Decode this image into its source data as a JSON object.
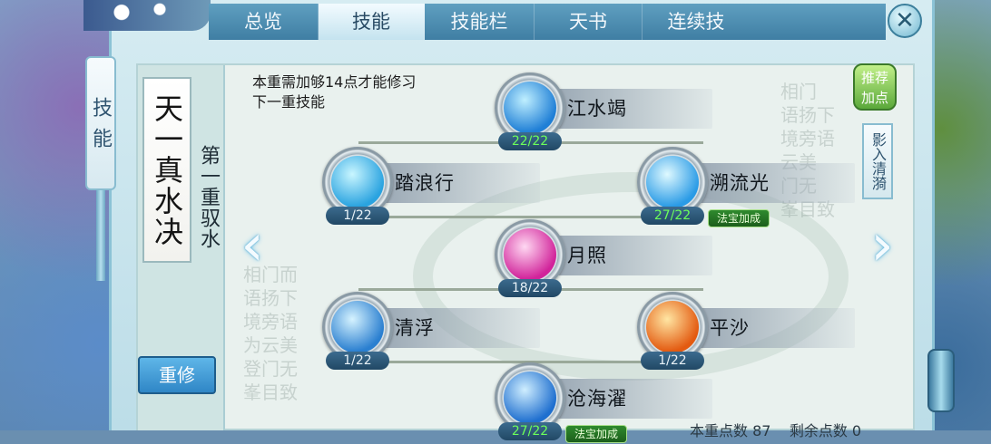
{
  "tabs": [
    {
      "label": "总览",
      "active": false
    },
    {
      "label": "技能",
      "active": true
    },
    {
      "label": "技能栏",
      "active": false
    },
    {
      "label": "天书",
      "active": false
    },
    {
      "label": "连续技",
      "active": false
    }
  ],
  "side_tab": "技能",
  "school_title": "天一真水决",
  "layer_title": "第一重驭水",
  "note": "本重需加够14点才能修习下一重技能",
  "reset_label": "重修",
  "recommend_label": "推荐加点",
  "shadow_label": "影入清漪",
  "fabao_label": "法宝加成",
  "skills": [
    {
      "name": "江水竭",
      "level": "22/22",
      "max": true,
      "fabao": false,
      "color1": "#bfefff",
      "color2": "#1f7fd6"
    },
    {
      "name": "踏浪行",
      "level": "1/22",
      "max": false,
      "fabao": false,
      "color1": "#c9f6ff",
      "color2": "#2aa3e0"
    },
    {
      "name": "溯流光",
      "level": "27/22",
      "max": true,
      "fabao": true,
      "color1": "#dff9ff",
      "color2": "#2a9be6"
    },
    {
      "name": "月照",
      "level": "18/22",
      "max": false,
      "fabao": false,
      "color1": "#ffd8f2",
      "color2": "#d1239a"
    },
    {
      "name": "清浮",
      "level": "1/22",
      "max": false,
      "fabao": false,
      "color1": "#d6f3ff",
      "color2": "#2a7fd0"
    },
    {
      "name": "平沙",
      "level": "1/22",
      "max": false,
      "fabao": false,
      "color1": "#ffe6a3",
      "color2": "#e35a10"
    },
    {
      "name": "沧海濯",
      "level": "27/22",
      "max": true,
      "fabao": true,
      "color1": "#cfeeff",
      "color2": "#1f6fcf"
    }
  ],
  "points": {
    "current_label": "本重点数",
    "current_value": "87",
    "remain_label": "剩余点数",
    "remain_value": "0"
  },
  "icons": {
    "close": "close-icon",
    "left": "chevron-left-icon",
    "right": "chevron-right-icon"
  }
}
